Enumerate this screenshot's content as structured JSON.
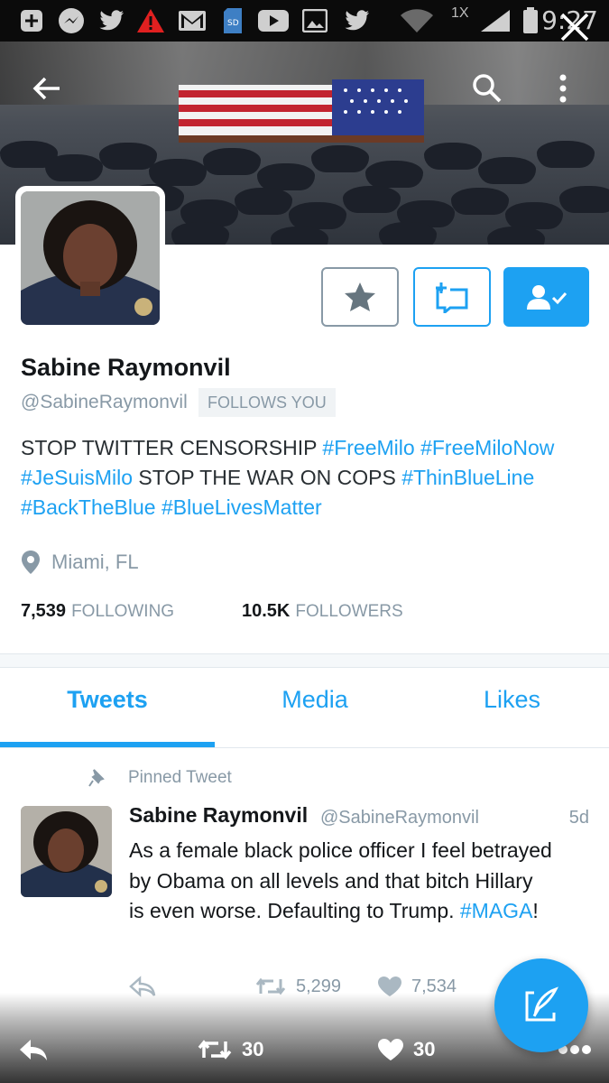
{
  "status_bar": {
    "time": "9:27",
    "speed": "1X"
  },
  "profile": {
    "name": "Sabine Raymonvil",
    "handle": "@SabineRaymonvil",
    "follows_you": "FOLLOWS YOU",
    "bio": {
      "line1_text": "STOP TWITTER CENSORSHIP ",
      "tag_freemilo": "#FreeMilo",
      "tag_freemilonow": "#FreeMiloNow",
      "tag_jesuismilo": "#JeSuisMilo",
      "line2_text": " STOP THE WAR ON COPS ",
      "tag_thinblueline": "#ThinBlueLine",
      "tag_backtheblue": "#BackTheBlue",
      "tag_bluelivesmatter": "#BlueLivesMatter"
    },
    "location": "Miami, FL",
    "following_count": "7,539",
    "following_label": "FOLLOWING",
    "followers_count": "10.5K",
    "followers_label": "FOLLOWERS"
  },
  "tabs": [
    {
      "label": "Tweets",
      "selected": true
    },
    {
      "label": "Media",
      "selected": false
    },
    {
      "label": "Likes",
      "selected": false
    }
  ],
  "pinned_tweet": {
    "pinned_label": "Pinned Tweet",
    "author_name": "Sabine Raymonvil",
    "author_handle": "@SabineRaymonvil",
    "time": "5d",
    "text": "As a female black police officer I feel betrayed by Obama on all levels and that bitch Hillary is even worse. Defaulting to Trump. ",
    "hashtag": "#MAGA",
    "text_end": "!",
    "retweets": "5,299",
    "likes": "7,534"
  },
  "bottom_bar": {
    "retweets": "30",
    "likes": "30"
  },
  "colors": {
    "accent": "#1da1f2",
    "muted": "#8899a6",
    "text": "#14171a"
  },
  "icons": [
    "back-arrow-icon",
    "search-icon",
    "more-vert-icon",
    "close-icon",
    "star-icon",
    "direct-message-icon",
    "follow-check-icon",
    "location-pin-icon",
    "pin-icon",
    "reply-icon",
    "retweet-icon",
    "heart-icon",
    "compose-icon",
    "more-horiz-icon"
  ]
}
